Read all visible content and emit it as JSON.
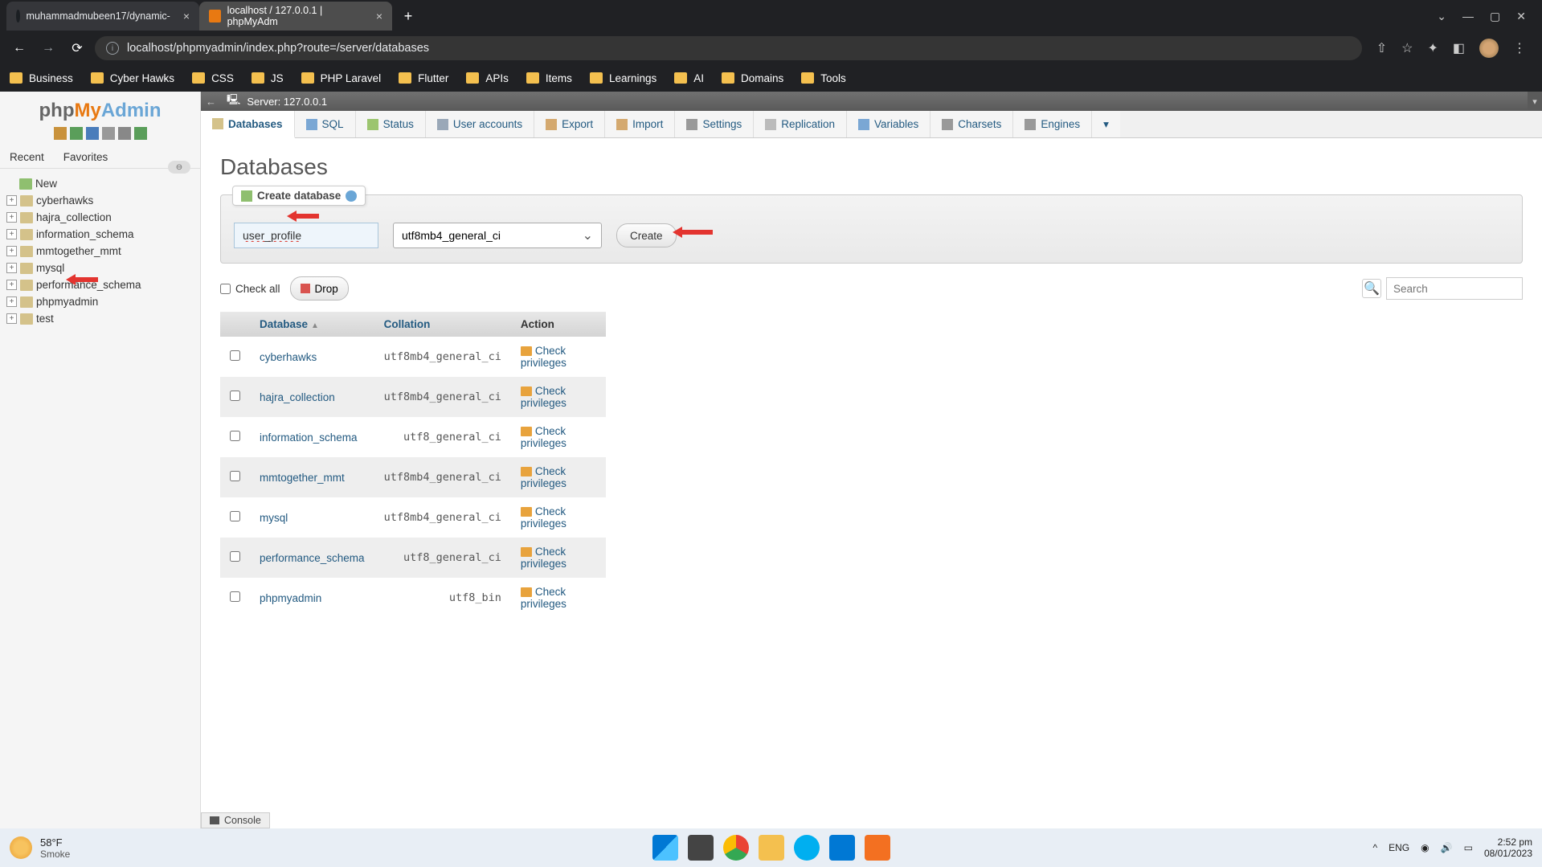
{
  "browser": {
    "tabs": [
      {
        "title": "muhammadmubeen17/dynamic-"
      },
      {
        "title": "localhost / 127.0.0.1 | phpMyAdm"
      }
    ],
    "url": "localhost/phpmyadmin/index.php?route=/server/databases",
    "bookmarks": [
      "Business",
      "Cyber Hawks",
      "CSS",
      "JS",
      "PHP Laravel",
      "Flutter",
      "APIs",
      "Items",
      "Learnings",
      "AI",
      "Domains",
      "Tools"
    ]
  },
  "pma": {
    "logo": {
      "p1": "php",
      "p2": "My",
      "p3": "Admin"
    },
    "nav_tabs": {
      "recent": "Recent",
      "favorites": "Favorites"
    },
    "tree": {
      "new": "New",
      "items": [
        "cyberhawks",
        "hajra_collection",
        "information_schema",
        "mmtogether_mmt",
        "mysql",
        "performance_schema",
        "phpmyadmin",
        "test"
      ]
    },
    "server_label": "Server: 127.0.0.1",
    "top_tabs": [
      "Databases",
      "SQL",
      "Status",
      "User accounts",
      "Export",
      "Import",
      "Settings",
      "Replication",
      "Variables",
      "Charsets",
      "Engines"
    ],
    "page_heading": "Databases",
    "create": {
      "legend": "Create database",
      "input_value": "user_profile",
      "collation": "utf8mb4_general_ci",
      "button": "Create"
    },
    "toolbar": {
      "check_all": "Check all",
      "drop": "Drop",
      "search_placeholder": "Search"
    },
    "table": {
      "headers": {
        "db": "Database",
        "coll": "Collation",
        "action": "Action"
      },
      "privileges_label": "Check privileges",
      "rows": [
        {
          "name": "cyberhawks",
          "coll": "utf8mb4_general_ci"
        },
        {
          "name": "hajra_collection",
          "coll": "utf8mb4_general_ci"
        },
        {
          "name": "information_schema",
          "coll": "utf8_general_ci"
        },
        {
          "name": "mmtogether_mmt",
          "coll": "utf8mb4_general_ci"
        },
        {
          "name": "mysql",
          "coll": "utf8mb4_general_ci"
        },
        {
          "name": "performance_schema",
          "coll": "utf8_general_ci"
        },
        {
          "name": "phpmyadmin",
          "coll": "utf8_bin"
        }
      ]
    },
    "console": "Console"
  },
  "taskbar": {
    "temp": "58°F",
    "cond": "Smoke",
    "lang": "ENG",
    "time": "2:52 pm",
    "date": "08/01/2023"
  }
}
